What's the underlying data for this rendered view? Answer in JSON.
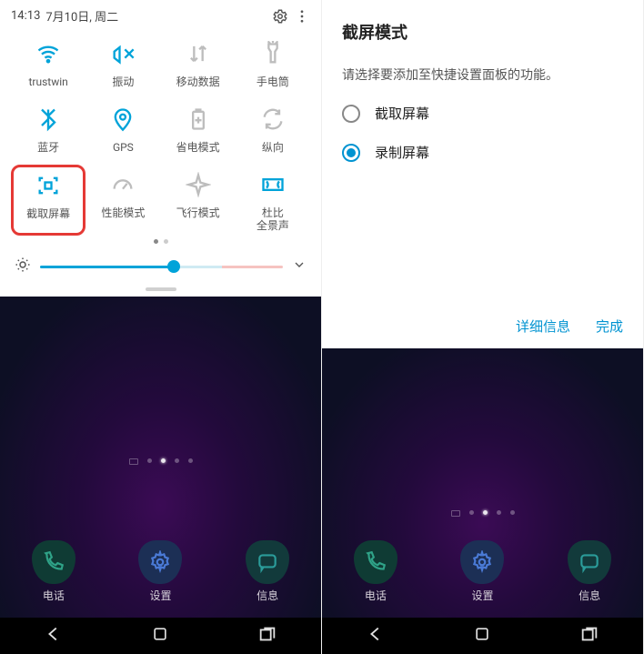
{
  "status": {
    "time": "14:13",
    "date": "7月10日, 周二"
  },
  "tiles": [
    {
      "id": "wifi",
      "label": "trustwin",
      "on": true
    },
    {
      "id": "vibrate",
      "label": "振动",
      "on": true
    },
    {
      "id": "data",
      "label": "移动数据",
      "on": false
    },
    {
      "id": "flashlight",
      "label": "手电筒",
      "on": false
    },
    {
      "id": "bluetooth",
      "label": "蓝牙",
      "on": true
    },
    {
      "id": "gps",
      "label": "GPS",
      "on": true
    },
    {
      "id": "battery",
      "label": "省电模式",
      "on": false
    },
    {
      "id": "rotate",
      "label": "纵向",
      "on": false
    },
    {
      "id": "screenshot",
      "label": "截取屏幕",
      "on": true,
      "highlight": true
    },
    {
      "id": "perf",
      "label": "性能模式",
      "on": false
    },
    {
      "id": "airplane",
      "label": "飞行模式",
      "on": false
    },
    {
      "id": "dolby",
      "label": "杜比\n全景声",
      "on": true
    }
  ],
  "dock": [
    {
      "id": "phone",
      "label": "电话"
    },
    {
      "id": "settings",
      "label": "设置"
    },
    {
      "id": "messages",
      "label": "信息"
    }
  ],
  "detail": {
    "title": "截屏模式",
    "desc": "请选择要添加至快捷设置面板的功能。",
    "options": [
      {
        "id": "capture",
        "label": "截取屏幕",
        "selected": false
      },
      {
        "id": "record",
        "label": "录制屏幕",
        "selected": true
      }
    ],
    "more": "详细信息",
    "done": "完成"
  }
}
